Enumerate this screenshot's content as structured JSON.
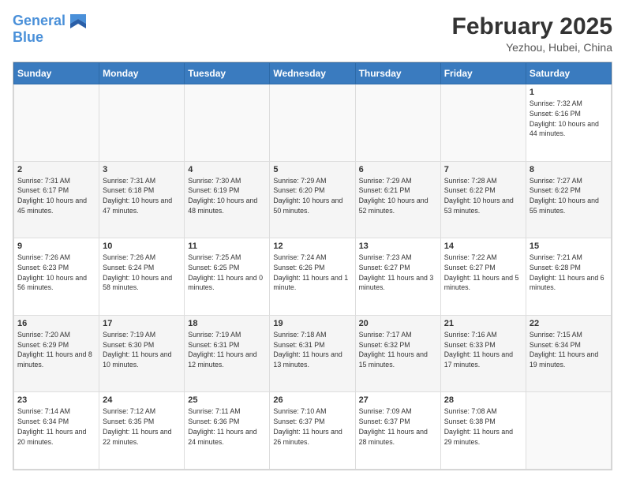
{
  "logo": {
    "line1": "General",
    "line2": "Blue"
  },
  "title": "February 2025",
  "subtitle": "Yezhou, Hubei, China",
  "days_of_week": [
    "Sunday",
    "Monday",
    "Tuesday",
    "Wednesday",
    "Thursday",
    "Friday",
    "Saturday"
  ],
  "weeks": [
    [
      {
        "day": "",
        "info": ""
      },
      {
        "day": "",
        "info": ""
      },
      {
        "day": "",
        "info": ""
      },
      {
        "day": "",
        "info": ""
      },
      {
        "day": "",
        "info": ""
      },
      {
        "day": "",
        "info": ""
      },
      {
        "day": "1",
        "info": "Sunrise: 7:32 AM\nSunset: 6:16 PM\nDaylight: 10 hours and 44 minutes."
      }
    ],
    [
      {
        "day": "2",
        "info": "Sunrise: 7:31 AM\nSunset: 6:17 PM\nDaylight: 10 hours and 45 minutes."
      },
      {
        "day": "3",
        "info": "Sunrise: 7:31 AM\nSunset: 6:18 PM\nDaylight: 10 hours and 47 minutes."
      },
      {
        "day": "4",
        "info": "Sunrise: 7:30 AM\nSunset: 6:19 PM\nDaylight: 10 hours and 48 minutes."
      },
      {
        "day": "5",
        "info": "Sunrise: 7:29 AM\nSunset: 6:20 PM\nDaylight: 10 hours and 50 minutes."
      },
      {
        "day": "6",
        "info": "Sunrise: 7:29 AM\nSunset: 6:21 PM\nDaylight: 10 hours and 52 minutes."
      },
      {
        "day": "7",
        "info": "Sunrise: 7:28 AM\nSunset: 6:22 PM\nDaylight: 10 hours and 53 minutes."
      },
      {
        "day": "8",
        "info": "Sunrise: 7:27 AM\nSunset: 6:22 PM\nDaylight: 10 hours and 55 minutes."
      }
    ],
    [
      {
        "day": "9",
        "info": "Sunrise: 7:26 AM\nSunset: 6:23 PM\nDaylight: 10 hours and 56 minutes."
      },
      {
        "day": "10",
        "info": "Sunrise: 7:26 AM\nSunset: 6:24 PM\nDaylight: 10 hours and 58 minutes."
      },
      {
        "day": "11",
        "info": "Sunrise: 7:25 AM\nSunset: 6:25 PM\nDaylight: 11 hours and 0 minutes."
      },
      {
        "day": "12",
        "info": "Sunrise: 7:24 AM\nSunset: 6:26 PM\nDaylight: 11 hours and 1 minute."
      },
      {
        "day": "13",
        "info": "Sunrise: 7:23 AM\nSunset: 6:27 PM\nDaylight: 11 hours and 3 minutes."
      },
      {
        "day": "14",
        "info": "Sunrise: 7:22 AM\nSunset: 6:27 PM\nDaylight: 11 hours and 5 minutes."
      },
      {
        "day": "15",
        "info": "Sunrise: 7:21 AM\nSunset: 6:28 PM\nDaylight: 11 hours and 6 minutes."
      }
    ],
    [
      {
        "day": "16",
        "info": "Sunrise: 7:20 AM\nSunset: 6:29 PM\nDaylight: 11 hours and 8 minutes."
      },
      {
        "day": "17",
        "info": "Sunrise: 7:19 AM\nSunset: 6:30 PM\nDaylight: 11 hours and 10 minutes."
      },
      {
        "day": "18",
        "info": "Sunrise: 7:19 AM\nSunset: 6:31 PM\nDaylight: 11 hours and 12 minutes."
      },
      {
        "day": "19",
        "info": "Sunrise: 7:18 AM\nSunset: 6:31 PM\nDaylight: 11 hours and 13 minutes."
      },
      {
        "day": "20",
        "info": "Sunrise: 7:17 AM\nSunset: 6:32 PM\nDaylight: 11 hours and 15 minutes."
      },
      {
        "day": "21",
        "info": "Sunrise: 7:16 AM\nSunset: 6:33 PM\nDaylight: 11 hours and 17 minutes."
      },
      {
        "day": "22",
        "info": "Sunrise: 7:15 AM\nSunset: 6:34 PM\nDaylight: 11 hours and 19 minutes."
      }
    ],
    [
      {
        "day": "23",
        "info": "Sunrise: 7:14 AM\nSunset: 6:34 PM\nDaylight: 11 hours and 20 minutes."
      },
      {
        "day": "24",
        "info": "Sunrise: 7:12 AM\nSunset: 6:35 PM\nDaylight: 11 hours and 22 minutes."
      },
      {
        "day": "25",
        "info": "Sunrise: 7:11 AM\nSunset: 6:36 PM\nDaylight: 11 hours and 24 minutes."
      },
      {
        "day": "26",
        "info": "Sunrise: 7:10 AM\nSunset: 6:37 PM\nDaylight: 11 hours and 26 minutes."
      },
      {
        "day": "27",
        "info": "Sunrise: 7:09 AM\nSunset: 6:37 PM\nDaylight: 11 hours and 28 minutes."
      },
      {
        "day": "28",
        "info": "Sunrise: 7:08 AM\nSunset: 6:38 PM\nDaylight: 11 hours and 29 minutes."
      },
      {
        "day": "",
        "info": ""
      }
    ]
  ]
}
